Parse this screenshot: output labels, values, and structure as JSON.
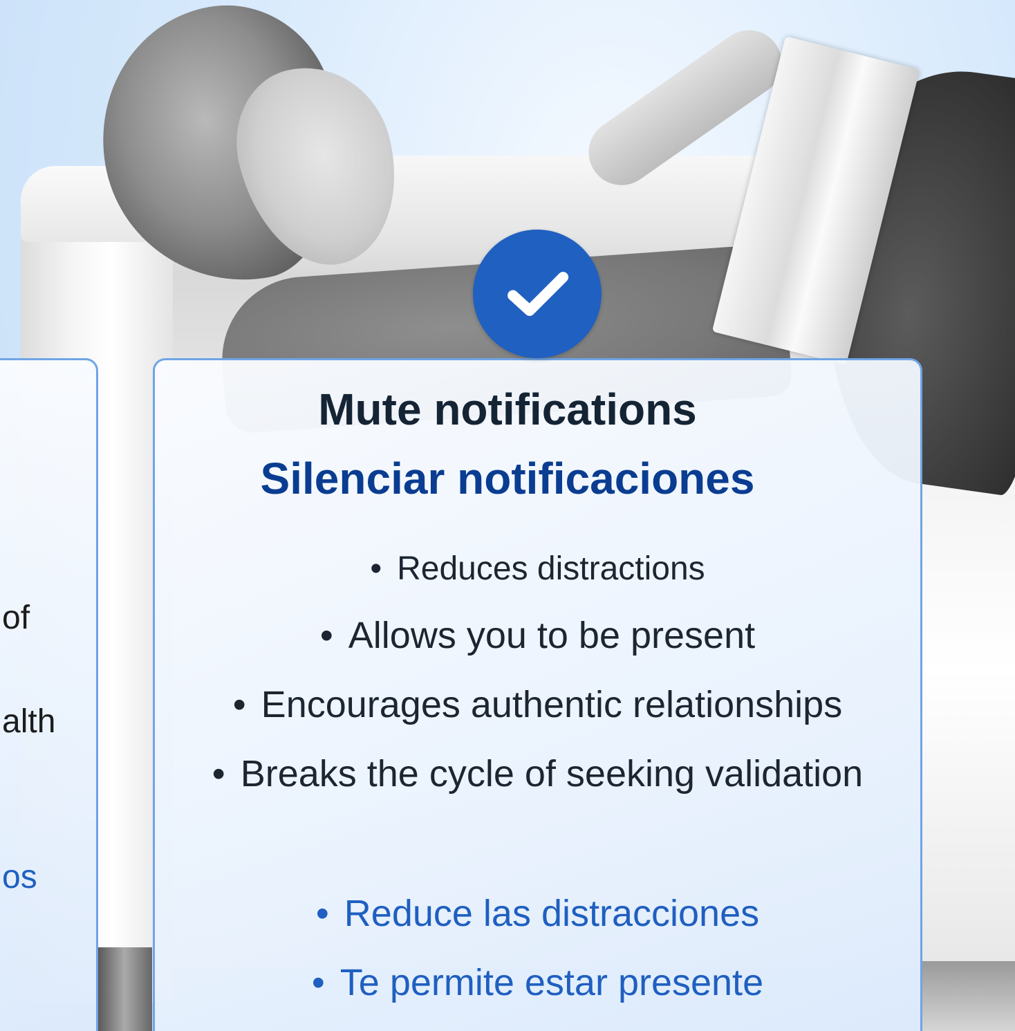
{
  "left_card": {
    "fragments": [
      "of",
      "alth",
      "os"
    ]
  },
  "main_card": {
    "title_en": "Mute notifications",
    "title_es": "Silenciar notificaciones",
    "bullets_en": [
      "Reduces distractions",
      "Allows you to be present",
      "Encourages authentic relationships",
      "Breaks the cycle of seeking validation"
    ],
    "bullets_es": [
      "Reduce las distracciones",
      "Te permite estar presente"
    ],
    "bullet_glyph": "•"
  },
  "badge": {
    "icon": "check-icon",
    "color": "#2060c0"
  },
  "colors": {
    "title_en": "#152434",
    "title_es": "#0a3d91",
    "text_es": "#1f5fc0",
    "card_border": "#6fa4e6"
  }
}
